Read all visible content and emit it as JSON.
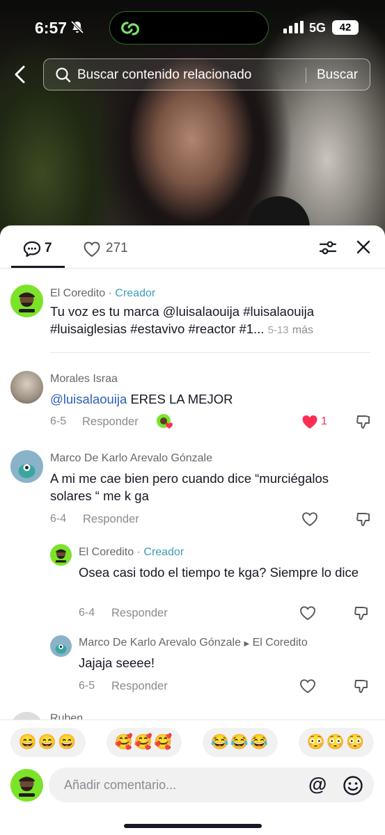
{
  "status_bar": {
    "time": "6:57",
    "network": "5G",
    "battery": "42"
  },
  "search": {
    "placeholder": "Buscar contenido relacionado",
    "button": "Buscar"
  },
  "tabs": {
    "comments_count": "7",
    "likes_count": "271"
  },
  "comments": [
    {
      "user": "El Coredito",
      "badge": "· Creador",
      "text": "Tu voz es tu marca  @luisalaouija   #luisalaouija #luisaiglesias #estavivo #reactor #1...",
      "date": "5-13",
      "more": "más"
    },
    {
      "user": "Morales Israa",
      "mention": "@luisalaouija",
      "text": " ERES LA MEJOR",
      "date": "6-5",
      "reply": "Responder",
      "likes": "1"
    },
    {
      "user": "Marco De Karlo Arevalo Gónzale",
      "text": "A mi me cae bien pero cuando dice “murciégalos solares “ me k ga",
      "date": "6-4",
      "reply": "Responder"
    },
    {
      "user": "El Coredito",
      "badge": "· Creador",
      "text": "Osea casi todo el tiempo te kga? Siempre lo dice",
      "date": "6-4",
      "reply": "Responder"
    },
    {
      "user": "Marco De Karlo Arevalo Gónzale",
      "reply_to": "El Coredito",
      "text": "Jajaja seeee!",
      "date": "6-5",
      "reply": "Responder"
    }
  ],
  "partial_next_user": "Ruben",
  "emoji_bar": [
    "😄😄😄",
    "🥰🥰🥰",
    "😂😂😂",
    "😳😳😳"
  ],
  "composer": {
    "placeholder": "Añadir comentario...",
    "at": "@"
  },
  "colors": {
    "creator": "#3b9cb8",
    "mention": "#2b5db8",
    "like_red": "#fe2c55",
    "avatar_green": "#7be32a"
  }
}
